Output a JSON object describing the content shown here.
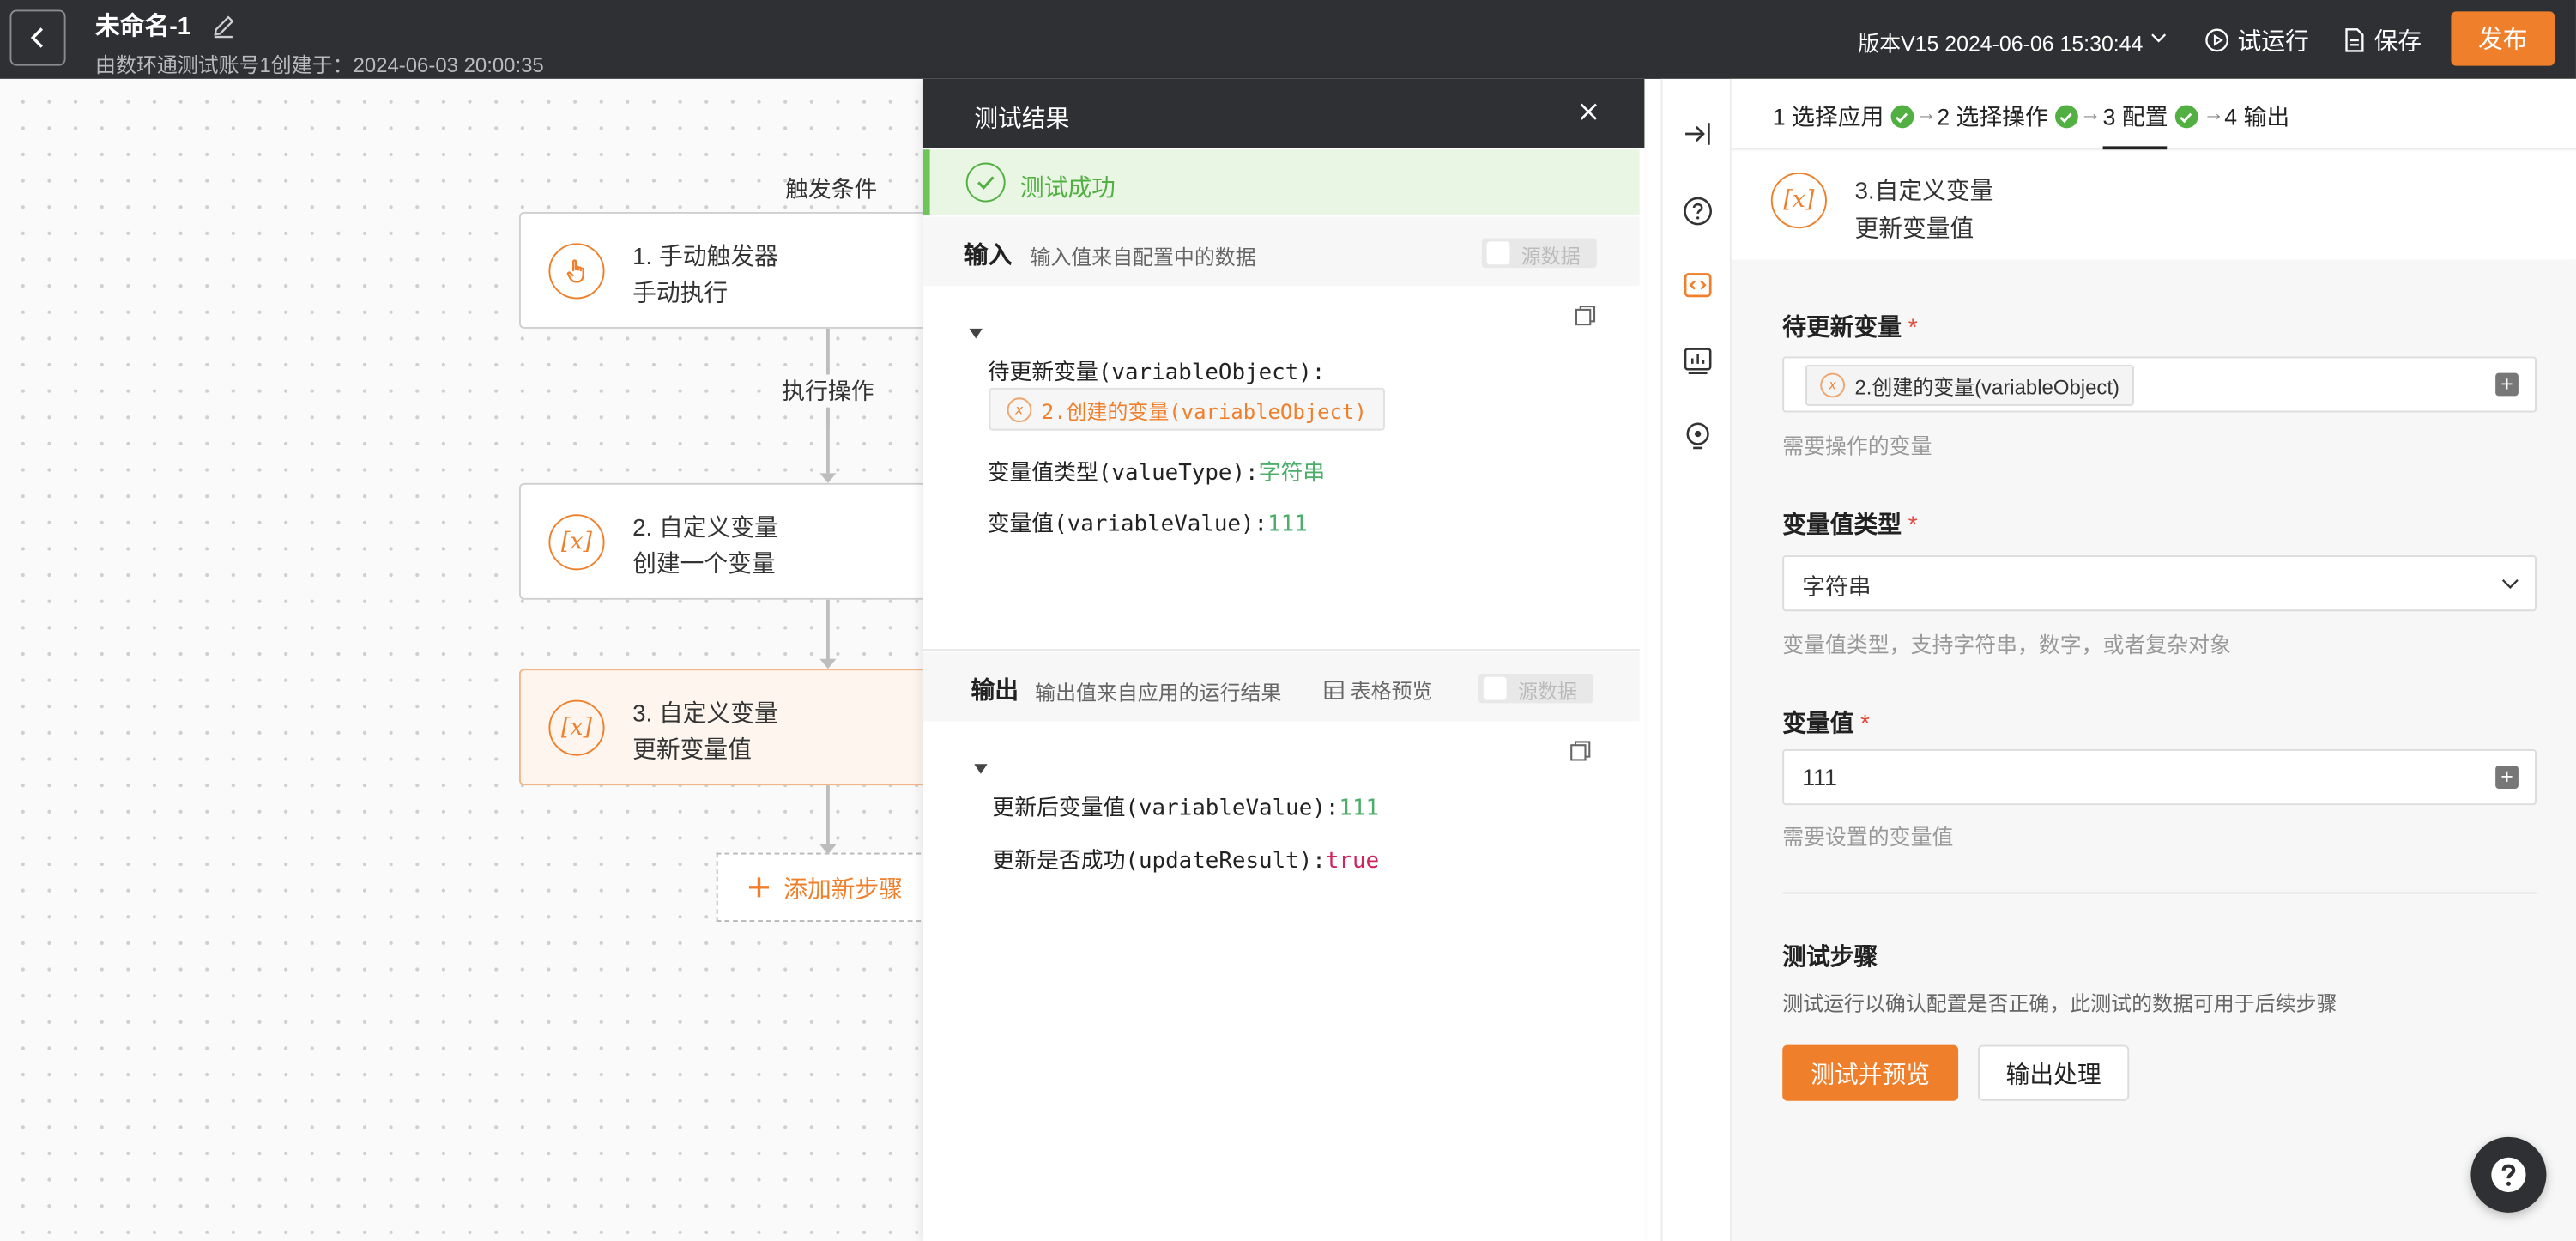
{
  "topbar": {
    "title": "未命名-1",
    "subtitle": "由数环通测试账号1创建于：2024-06-03 20:00:35",
    "version": "版本V15 2024-06-06 15:30:44",
    "trial_run": "试运行",
    "save": "保存",
    "publish": "发布"
  },
  "flow": {
    "trigger_label": "触发条件",
    "action_label": "执行操作",
    "nodes": [
      {
        "title": "1. 手动触发器",
        "subtitle": "手动执行",
        "icon": "hand-pointer-icon"
      },
      {
        "title": "2. 自定义变量",
        "subtitle": "创建一个变量",
        "icon": "variable-icon"
      },
      {
        "title": "3. 自定义变量",
        "subtitle": "更新变量值",
        "icon": "variable-icon"
      }
    ],
    "add_step": "添加新步骤"
  },
  "result": {
    "title": "测试结果",
    "status": "测试成功",
    "input": {
      "title": "输入",
      "desc": "输入值来自配置中的数据",
      "toggle_label": "源数据",
      "lines": {
        "k1": "待更新变量(variableObject):",
        "chip": "2.创建的变量(variableObject)",
        "k2": "变量值类型(valueType):",
        "v2": "字符串",
        "k3": "变量值(variableValue):",
        "v3": "111"
      }
    },
    "output": {
      "title": "输出",
      "desc": "输出值来自应用的运行结果",
      "table_preview": "表格预览",
      "toggle_label": "源数据",
      "lines": {
        "k1": "更新后变量值(variableValue):",
        "v1": "111",
        "k2": "更新是否成功(updateResult):",
        "v2": "true"
      }
    }
  },
  "config": {
    "steps": [
      {
        "label": "1 选择应用",
        "done": true
      },
      {
        "label": "2 选择操作",
        "done": true
      },
      {
        "label": "3 配置",
        "done": true,
        "active": true
      },
      {
        "label": "4 输出",
        "done": false
      }
    ],
    "header": {
      "l1": "3.自定义变量",
      "l2": "更新变量值"
    },
    "fields": {
      "var": {
        "label": "待更新变量",
        "chip": "2.创建的变量(variableObject)",
        "hint": "需要操作的变量"
      },
      "type": {
        "label": "变量值类型",
        "value": "字符串",
        "hint": "变量值类型，支持字符串，数字，或者复杂对象"
      },
      "value": {
        "label": "变量值",
        "value": "111",
        "hint": "需要设置的变量值"
      }
    },
    "test": {
      "title": "测试步骤",
      "desc": "测试运行以确认配置是否正确，此测试的数据可用于后续步骤",
      "btn_test": "测试并预览",
      "btn_output": "输出处理"
    }
  },
  "colors": {
    "accent": "#ef7f2a",
    "success": "#52b043",
    "topbar": "#2f3034"
  }
}
